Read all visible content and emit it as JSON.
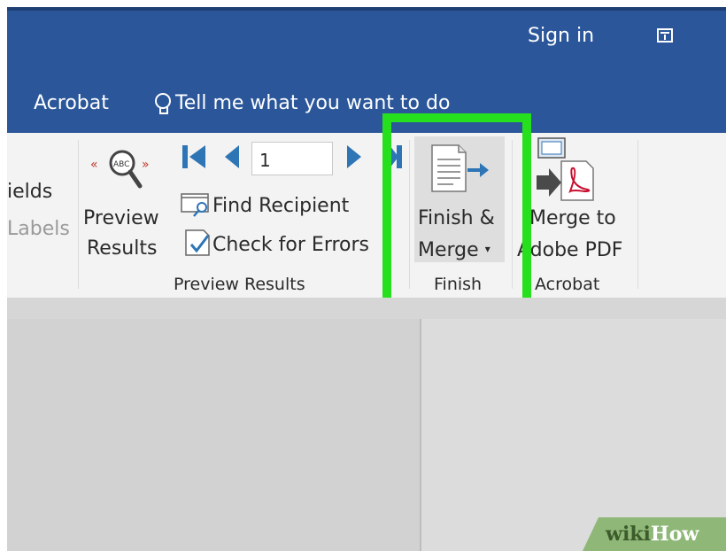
{
  "titlebar": {
    "sign_in": "Sign in",
    "restore_icon": "restore-window-icon",
    "color": "#2b579a"
  },
  "tabs": {
    "acrobat": "Acrobat",
    "tell_me": "Tell me what you want to do",
    "tell_me_icon": "lightbulb-icon"
  },
  "ribbon": {
    "fields_partial": "ields",
    "labels_partial": "Labels",
    "preview_results": {
      "label_line1": "Preview",
      "label_line2": "Results",
      "icon": "abc-magnifier-icon"
    },
    "record_nav": {
      "current": "1",
      "icons": [
        "first-record-icon",
        "previous-record-icon",
        "next-record-icon",
        "last-record-icon"
      ]
    },
    "find_recipient": "Find Recipient",
    "check_for_errors": "Check for Errors",
    "preview_group": "Preview Results",
    "finish": {
      "label_line1": "Finish &",
      "label_line2": "Merge",
      "dropdown": "▾",
      "group": "Finish",
      "icon": "finish-merge-icon"
    },
    "merge_pdf": {
      "label_line1": "Merge to",
      "label_line2": "Adobe PDF",
      "group": "Acrobat",
      "icon": "merge-to-pdf-icon"
    }
  },
  "highlight_color": "#27e01d",
  "watermark": {
    "part1": "wiki",
    "part2": "How"
  }
}
